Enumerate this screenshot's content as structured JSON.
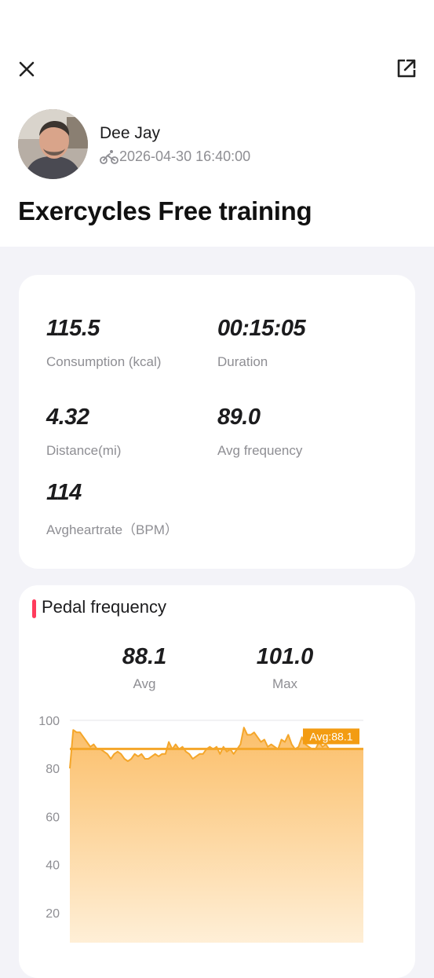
{
  "header": {
    "close_icon": "close-icon",
    "share_icon": "share-icon"
  },
  "profile": {
    "name": "Dee Jay",
    "activity_icon": "bicycle-icon",
    "datetime": "2026-04-30 16:40:00",
    "title": "Exercycles Free training"
  },
  "stats": [
    {
      "value": "115.5",
      "label": "Consumption (kcal)"
    },
    {
      "value": "00:15:05",
      "label": "Duration"
    },
    {
      "value": "4.32",
      "label": "Distance(mi)"
    },
    {
      "value": "89.0",
      "label": "Avg frequency"
    },
    {
      "value": "114",
      "label": "Avgheartrate（BPM）"
    }
  ],
  "pedal": {
    "title": "Pedal frequency",
    "avg_value": "88.1",
    "avg_label": "Avg",
    "max_value": "101.0",
    "max_label": "Max",
    "avg_marker_label": "Avg:88.1"
  },
  "colors": {
    "accent_line": "#f4a62a",
    "fill_top": "#fbbf6a",
    "fill_bottom": "#fff3e0",
    "section_bar": "#ff3b5c"
  },
  "chart_data": {
    "type": "area",
    "title": "Pedal frequency",
    "xlabel": "",
    "ylabel": "",
    "ylim": [
      0,
      100
    ],
    "yticks": [
      20,
      40,
      60,
      80,
      100
    ],
    "grid": true,
    "avg_line": 88.1,
    "values": [
      80,
      96,
      95,
      95,
      93,
      91,
      89,
      90,
      88,
      88,
      87,
      86,
      84,
      86,
      87,
      86,
      84,
      83,
      84,
      86,
      85,
      86,
      84,
      84,
      85,
      86,
      85,
      86,
      86,
      91,
      88,
      90,
      88,
      89,
      87,
      86,
      84,
      85,
      86,
      86,
      88,
      89,
      88,
      89,
      86,
      89,
      87,
      88,
      86,
      88,
      90,
      97,
      94,
      94,
      95,
      93,
      91,
      92,
      89,
      90,
      89,
      88,
      92,
      91,
      94,
      90,
      88,
      89,
      93,
      90,
      89,
      88,
      88,
      91,
      89,
      90,
      88,
      88,
      88,
      88,
      88,
      88,
      88,
      88,
      88,
      88,
      88
    ]
  }
}
